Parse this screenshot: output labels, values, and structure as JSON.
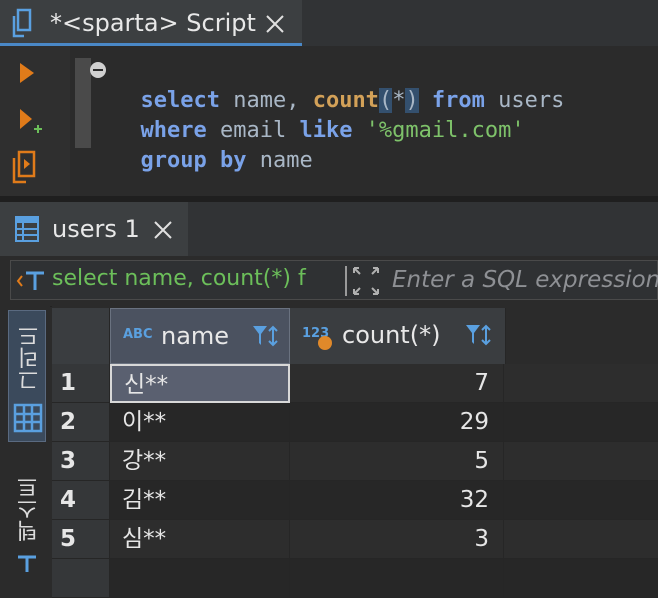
{
  "editor": {
    "tab_title": "*<sparta> Script",
    "code": {
      "l1_select": "select",
      "l1_cols": " name, ",
      "l1_count": "count",
      "l1_open": "(",
      "l1_star": "*",
      "l1_close": ")",
      "l1_from": " from",
      "l1_table": " users",
      "l2_where": "where",
      "l2_col": " email ",
      "l2_like": "like",
      "l2_str": " '%gmail.com'",
      "l3_group": "group",
      "l3_by": " by",
      "l3_col": " name"
    }
  },
  "results": {
    "tab_title": "users 1",
    "filter_query": "select name, count(*) f",
    "filter_placeholder": "Enter a SQL expression to filter results (use Ctrl+Space)",
    "side_tabs": {
      "grid": "그리드",
      "text": "텍스트"
    },
    "columns": [
      {
        "type_badge": "ABC",
        "label": "name"
      },
      {
        "type_badge": "123",
        "label": "count(*)"
      }
    ],
    "rows": [
      {
        "num": "1",
        "name": "신**",
        "count": "7"
      },
      {
        "num": "2",
        "name": "이**",
        "count": "29"
      },
      {
        "num": "3",
        "name": "강**",
        "count": "5"
      },
      {
        "num": "4",
        "name": "김**",
        "count": "32"
      },
      {
        "num": "5",
        "name": "심**",
        "count": "3"
      },
      {
        "num": "",
        "name": "",
        "count": ""
      }
    ]
  },
  "colors": {
    "keyword": "#7aa2e8",
    "string": "#7ec26a",
    "selection_accent": "#4a88c7",
    "filter_query": "#6cbf5a",
    "toolbar_icon": "#e07b1a"
  },
  "icons": [
    "script-file-icon",
    "close-icon",
    "execute-icon",
    "execute-new-tab-icon",
    "execute-script-icon",
    "collapse-icon",
    "table-icon",
    "filter-icon",
    "sort-icon",
    "expand-icon",
    "grid-icon",
    "text-icon"
  ]
}
